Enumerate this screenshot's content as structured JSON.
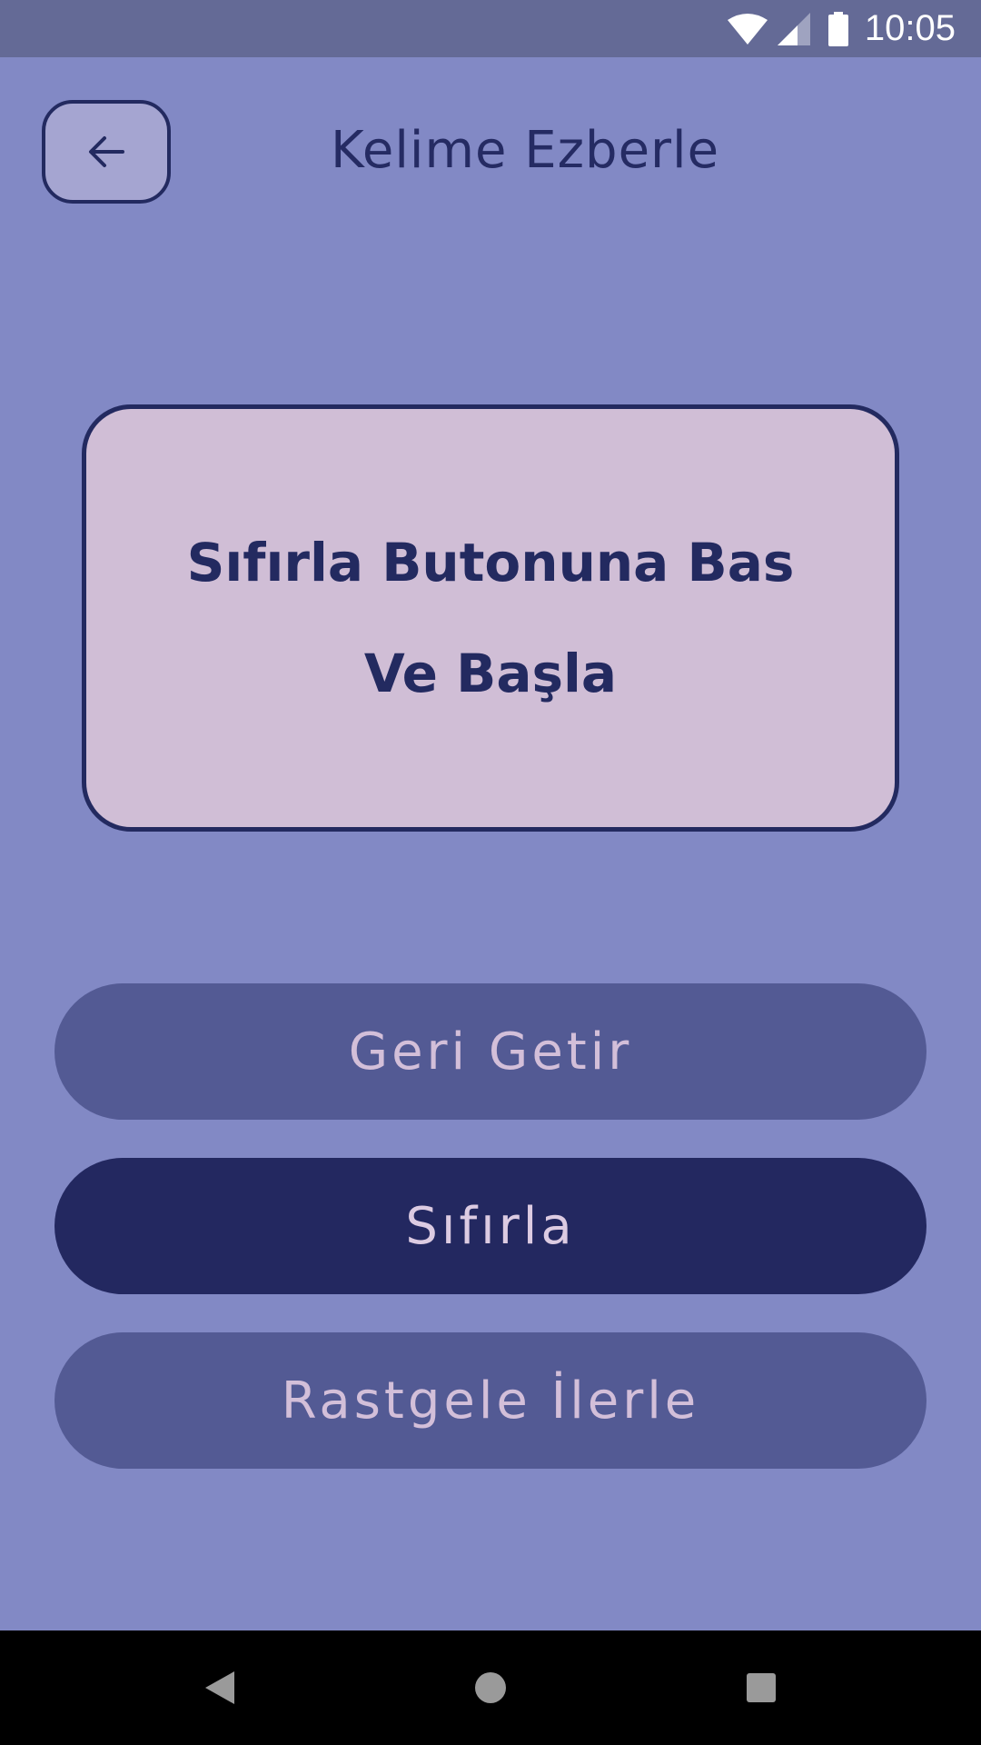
{
  "status_bar": {
    "time": "10:05",
    "icons": [
      "wifi-icon",
      "signal-icon",
      "battery-icon"
    ]
  },
  "header": {
    "title": "Kelime Ezberle",
    "back_icon": "arrow-left-icon"
  },
  "card": {
    "line1": "Sıfırla Butonuna Bas",
    "line2": "Ve Başla"
  },
  "actions": {
    "back_label": "Geri Getir",
    "reset_label": "Sıfırla",
    "random_label": "Rastgele İlerle"
  },
  "nav_bar": {
    "icons": [
      "nav-back-icon",
      "nav-home-icon",
      "nav-recents-icon"
    ]
  },
  "colors": {
    "background": "#8289c5",
    "status_bar": "#646a96",
    "accent_dark": "#232860",
    "button_muted": "#535a94",
    "card": "#d0bed6",
    "button_text": "#d3bfd9"
  }
}
